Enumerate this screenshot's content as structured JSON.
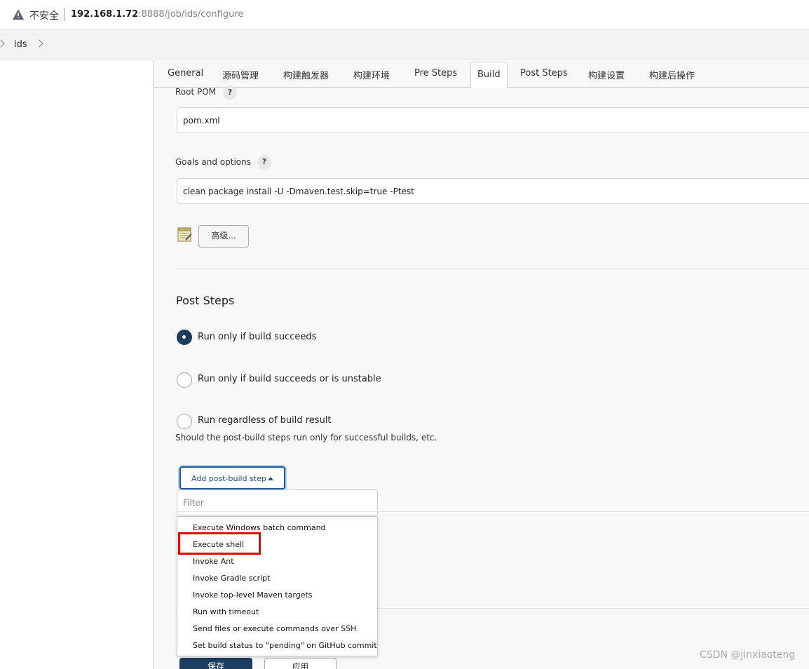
{
  "browser": {
    "insecure_label": "不安全",
    "url_host": "192.168.1.72",
    "url_path": ":8888/job/ids/configure"
  },
  "breadcrumb": {
    "item": "ids"
  },
  "tabs": [
    "General",
    "源码管理",
    "构建触发器",
    "构建环境",
    "Pre Steps",
    "Build",
    "Post Steps",
    "构建设置",
    "构建后操作"
  ],
  "active_tab": "Build",
  "build": {
    "root_pom_label": "Root POM",
    "root_pom_value": "pom.xml",
    "goals_label": "Goals and options",
    "goals_value": "clean package install -U -Dmaven.test.skip=true -Ptest",
    "help_glyph": "?",
    "advanced_label": "高级..."
  },
  "post_steps": {
    "title": "Post Steps",
    "options": [
      {
        "label": "Run only if build succeeds",
        "checked": true
      },
      {
        "label": "Run only if build succeeds or is unstable",
        "checked": false
      },
      {
        "label": "Run regardless of build result",
        "checked": false
      }
    ],
    "hint": "Should the post-build steps run only for successful builds, etc.",
    "add_button": "Add post-build step",
    "filter_placeholder": "Filter",
    "menu_items": [
      "Execute Windows batch command",
      "Execute shell",
      "Invoke Ant",
      "Invoke Gradle script",
      "Invoke top-level Maven targets",
      "Run with timeout",
      "Send files or execute commands over SSH",
      "Set build status to \"pending\" on GitHub commit"
    ],
    "highlighted_item": "Execute shell"
  },
  "footer": {
    "save": "保存",
    "apply": "应用"
  },
  "watermark": "CSDN @jinxiaoteng",
  "colors": {
    "primary": "#1c3d5f",
    "highlight": "#e60000",
    "link_blue": "#1f5b99"
  }
}
